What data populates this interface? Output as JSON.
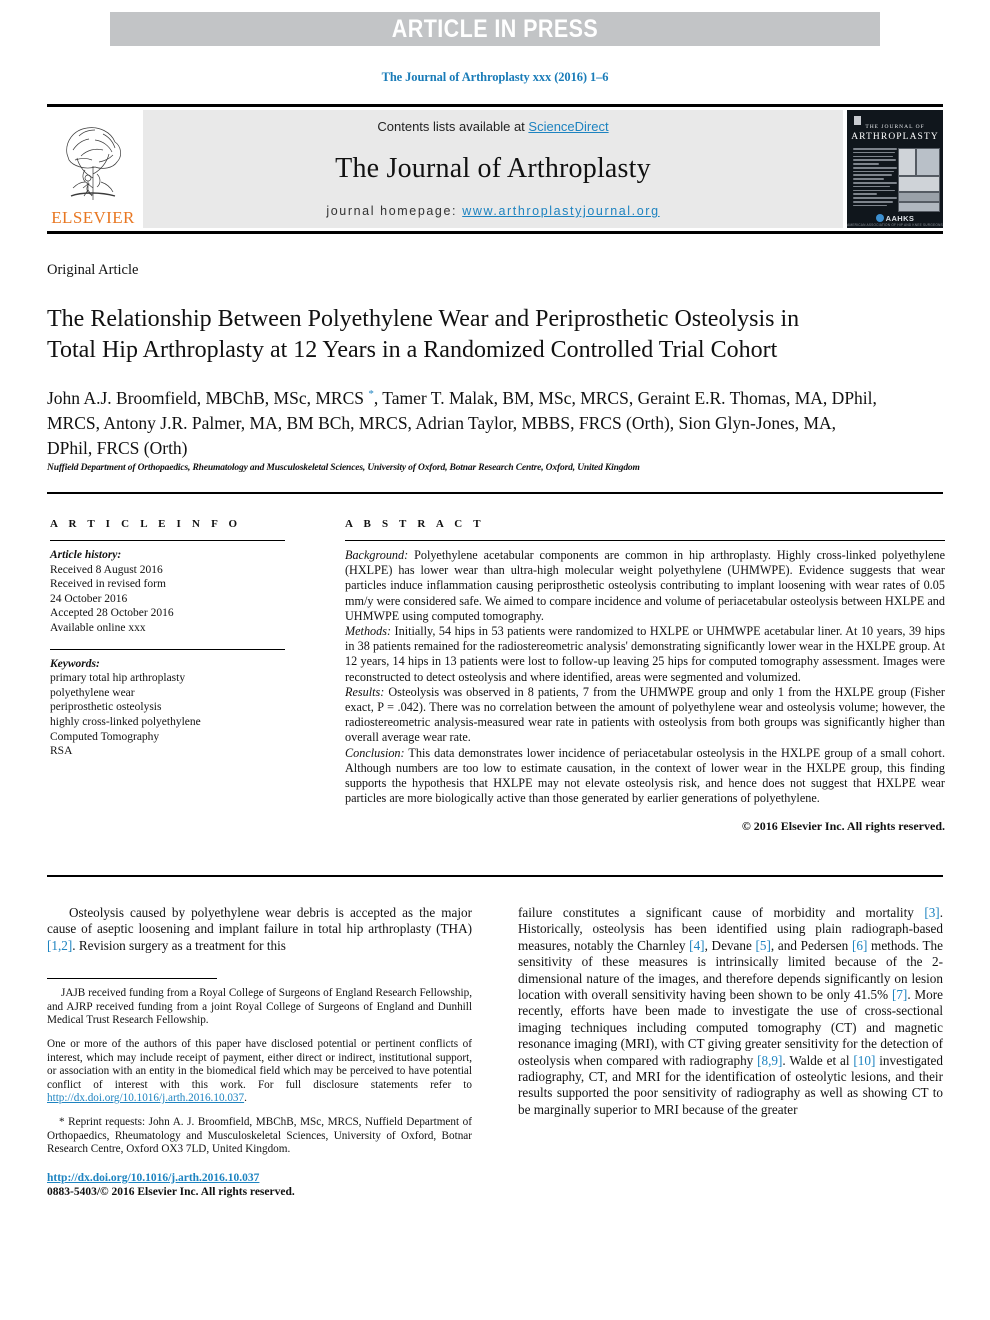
{
  "banner": {
    "text": "ARTICLE IN PRESS",
    "background": "#c2c4c6",
    "text_color": "#ffffff"
  },
  "citation_line": "The Journal of Arthroplasty xxx (2016) 1–6",
  "masthead": {
    "publisher_name": "ELSEVIER",
    "publisher_color": "#e87722",
    "contents_prefix": "Contents lists available at ",
    "contents_link": "ScienceDirect",
    "journal_title": "The Journal of Arthroplasty",
    "homepage_prefix": "journal homepage: ",
    "homepage_link": "www.arthroplastyjournal.org",
    "link_color": "#1d83c0",
    "cover": {
      "line1": "THE JOURNAL OF",
      "line2": "ARTHROPLASTY",
      "society": "AAHKS",
      "society_sub": "AMERICAN ASSOCIATION OF HIP AND KNEE SURGEONS",
      "background": "#10161c"
    }
  },
  "article": {
    "type": "Original Article",
    "title": "The Relationship Between Polyethylene Wear and Periprosthetic Osteolysis in Total Hip Arthroplasty at 12 Years in a Randomized Controlled Trial Cohort",
    "authors": "John A.J. Broomfield, MBChB, MSc, MRCS , Tamer T. Malak, BM, MSc, MRCS, Geraint E.R. Thomas, MA, DPhil, MRCS, Antony J.R. Palmer, MA, BM BCh, MRCS, Adrian Taylor, MBBS, FRCS (Orth), Sion Glyn-Jones, MA, DPhil, FRCS (Orth)",
    "author_marker": "*",
    "affiliation": "Nuffield Department of Orthopaedics, Rheumatology and Musculoskeletal Sciences, University of Oxford, Botnar Research Centre, Oxford, United Kingdom"
  },
  "info": {
    "heading": "A R T I C L E   I N F O",
    "history_label": "Article history:",
    "history": [
      "Received 8 August 2016",
      "Received in revised form",
      "24 October 2016",
      "Accepted 28 October 2016",
      "Available online xxx"
    ],
    "keywords_label": "Keywords:",
    "keywords": [
      "primary total hip arthroplasty",
      "polyethylene wear",
      "periprosthetic osteolysis",
      "highly cross-linked polyethylene",
      "Computed Tomography",
      "RSA"
    ]
  },
  "abstract": {
    "heading": "A B S T R A C T",
    "background_label": "Background:",
    "background_text": " Polyethylene acetabular components are common in hip arthroplasty. Highly cross-linked polyethylene (HXLPE) has lower wear than ultra-high molecular weight polyethylene (UHMWPE). Evidence suggests that wear particles induce inflammation causing periprosthetic osteolysis contributing to implant loosening with wear rates of 0.05 mm/y were considered safe. We aimed to compare incidence and volume of periacetabular osteolysis between HXLPE and UHMWPE using computed tomography.",
    "methods_label": "Methods:",
    "methods_text": " Initially, 54 hips in 53 patients were randomized to HXLPE or UHMWPE acetabular liner. At 10 years, 39 hips in 38 patients remained for the radiostereometric analysis' demonstrating significantly lower wear in the HXLPE group. At 12 years, 14 hips in 13 patients were lost to follow-up leaving 25 hips for computed tomography assessment. Images were reconstructed to detect osteolysis and where identified, areas were segmented and volumized.",
    "results_label": "Results:",
    "results_text": " Osteolysis was observed in 8 patients, 7 from the UHMWPE group and only 1 from the HXLPE group (Fisher exact, P = .042). There was no correlation between the amount of polyethylene wear and osteolysis volume; however, the radiostereometric analysis-measured wear rate in patients with osteolysis from both groups was significantly higher than overall average wear rate.",
    "conclusion_label": "Conclusion:",
    "conclusion_text": " This data demonstrates lower incidence of periacetabular osteolysis in the HXLPE group of a small cohort. Although numbers are too low to estimate causation, in the context of lower wear in the HXLPE group, this finding supports the hypothesis that HXLPE may not elevate osteolysis risk, and hence does not suggest that HXLPE wear particles are more biologically active than those generated by earlier generations of polyethylene.",
    "copyright": "© 2016 Elsevier Inc. All rights reserved."
  },
  "body": {
    "left_paragraph_1": "Osteolysis caused by polyethylene wear debris is accepted as the major cause of aseptic loosening and implant failure in total hip arthroplasty (THA) ",
    "left_ref_1": "[1,2]",
    "left_paragraph_1b": ". Revision surgery as a treatment for this",
    "right_paragraph": [
      {
        "text": "failure constitutes a significant cause of morbidity and mortality "
      },
      {
        "ref": "[3]"
      },
      {
        "text": ". Historically, osteolysis has been identified using plain radiograph-based measures, notably the Charnley "
      },
      {
        "ref": "[4]"
      },
      {
        "text": ", Devane "
      },
      {
        "ref": "[5]"
      },
      {
        "text": ", and Pedersen "
      },
      {
        "ref": "[6]"
      },
      {
        "text": " methods. The sensitivity of these measures is intrinsically limited because of the 2-dimensional nature of the images, and therefore depends significantly on lesion location with overall sensitivity having been shown to be only 41.5% "
      },
      {
        "ref": "[7]"
      },
      {
        "text": ". More recently, efforts have been made to investigate the use of cross-sectional imaging techniques including computed tomography (CT) and magnetic resonance imaging (MRI), with CT giving greater sensitivity for the detection of osteolysis when compared with radiography "
      },
      {
        "ref": "[8,9]"
      },
      {
        "text": ". Walde et al "
      },
      {
        "ref": "[10]"
      },
      {
        "text": " investigated radiography, CT, and MRI for the identification of osteolytic lesions, and their results supported the poor sensitivity of radiography as well as showing CT to be marginally superior to MRI because of the greater"
      }
    ]
  },
  "footnotes": {
    "funding": "JAJB received funding from a Royal College of Surgeons of England Research Fellowship, and AJRP received funding from a joint Royal College of Surgeons of England and Dunhill Medical Trust Research Fellowship.",
    "conflicts_pre": "One or more of the authors of this paper have disclosed potential or pertinent conflicts of interest, which may include receipt of payment, either direct or indirect, institutional support, or association with an entity in the biomedical field which may be perceived to have potential conflict of interest with this work. For full disclosure statements refer to ",
    "conflicts_link": "http://dx.doi.org/10.1016/j.arth.2016.10.037",
    "conflicts_post": ".",
    "reprint_marker": "*",
    "reprint": " Reprint requests: John A. J. Broomfield, MBChB, MSc, MRCS, Nuffield Department of Orthopaedics, Rheumatology and Musculoskeletal Sciences, University of Oxford, Botnar Research Centre, Oxford OX3 7LD, United Kingdom.",
    "doi_link": "http://dx.doi.org/10.1016/j.arth.2016.10.037",
    "issn_line": "0883-5403/© 2016 Elsevier Inc. All rights reserved."
  }
}
